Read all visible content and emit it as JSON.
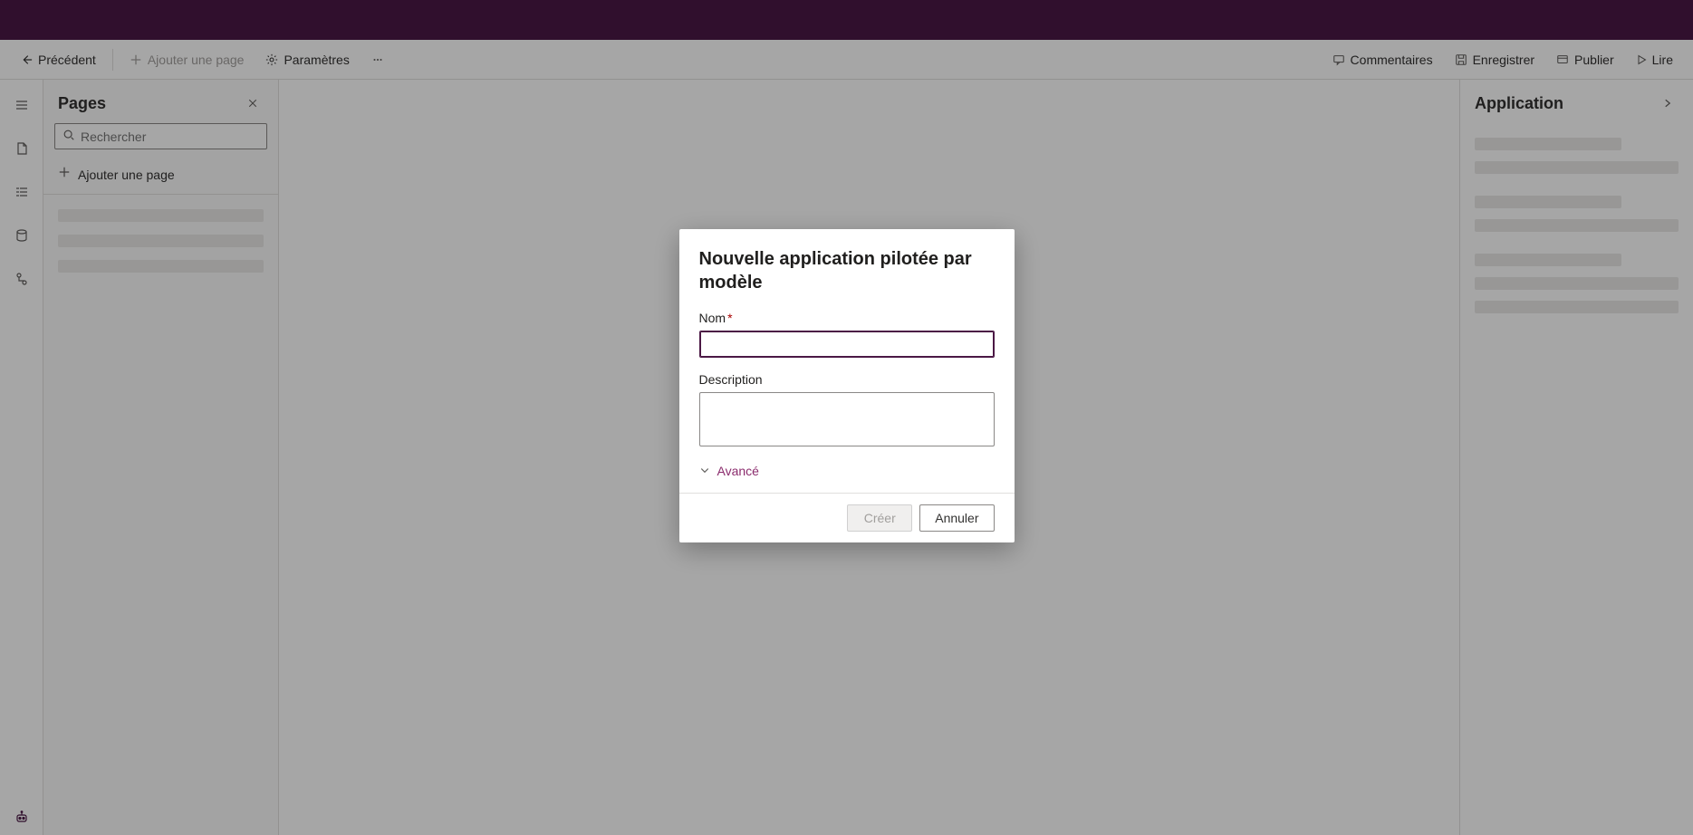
{
  "brandColor": "#4b1845",
  "commandbar": {
    "back": "Précédent",
    "addPage": "Ajouter une page",
    "settings": "Paramètres",
    "comments": "Commentaires",
    "save": "Enregistrer",
    "publish": "Publier",
    "play": "Lire"
  },
  "leftPane": {
    "title": "Pages",
    "searchPlaceholder": "Rechercher",
    "addPage": "Ajouter une page"
  },
  "rightPane": {
    "title": "Application"
  },
  "dialog": {
    "title": "Nouvelle application pilotée par modèle",
    "nameLabel": "Nom",
    "descriptionLabel": "Description",
    "advanced": "Avancé",
    "create": "Créer",
    "cancel": "Annuler"
  }
}
